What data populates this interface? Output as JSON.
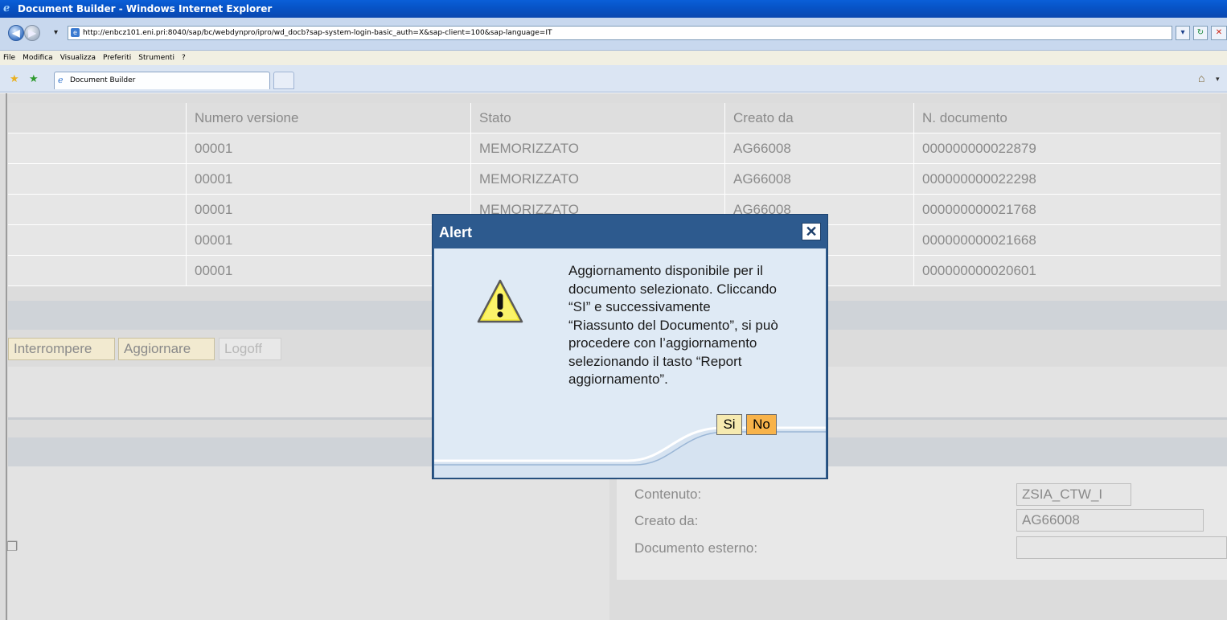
{
  "window": {
    "title": "Document Builder - Windows Internet Explorer"
  },
  "address_bar": {
    "url": "http://enbcz101.eni.pri:8040/sap/bc/webdynpro/ipro/wd_docb?sap-system-login-basic_auth=X&sap-client=100&sap-language=IT"
  },
  "menu": {
    "items": [
      "File",
      "Modifica",
      "Visualizza",
      "Preferiti",
      "Strumenti",
      "?"
    ]
  },
  "tabs": [
    {
      "label": "Document Builder"
    }
  ],
  "table": {
    "columns": [
      "",
      "Numero versione",
      "Stato",
      "Creato da",
      "N. documento"
    ],
    "rows": [
      [
        "",
        "00001",
        "MEMORIZZATO",
        "AG66008",
        "000000000022879"
      ],
      [
        "",
        "00001",
        "MEMORIZZATO",
        "AG66008",
        "000000000022298"
      ],
      [
        "",
        "00001",
        "MEMORIZZATO",
        "AG66008",
        "000000000021768"
      ],
      [
        "",
        "00001",
        "",
        "",
        "000000000021668"
      ],
      [
        "",
        "00001",
        "",
        "",
        "000000000020601"
      ]
    ]
  },
  "toolbar": {
    "interrompere": "Interrompere",
    "aggiornare": "Aggiornare",
    "logoff": "Logoff"
  },
  "details": {
    "contenuto_label": "Contenuto:",
    "contenuto_value": "ZSIA_CTW_I",
    "creato_da_label": "Creato da:",
    "creato_da_value": "AG66008",
    "documento_esterno_label": "Documento esterno:",
    "documento_esterno_value": ""
  },
  "alert": {
    "title": "Alert",
    "close_icon": "close-icon",
    "warning_icon": "warning-icon",
    "message_lines": [
      "Aggiornamento disponibile per il",
      "documento selezionato. Cliccando",
      "“SI” e successivamente",
      "“Riassunto del Documento”, si può",
      "procedere con l’aggiornamento",
      "selezionando il tasto “Report",
      "aggiornamento”."
    ],
    "yes_label": "Si",
    "no_label": "No",
    "colors": {
      "header": "#2d5a8e",
      "body": "#dfeaf5",
      "yes_button": "#f6eab0",
      "no_button": "#f8b34a"
    }
  }
}
